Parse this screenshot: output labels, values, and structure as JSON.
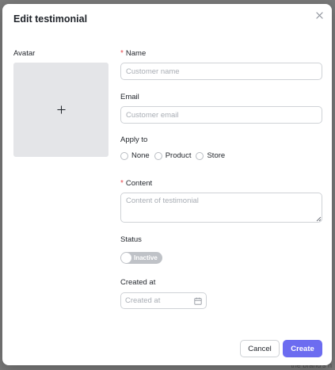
{
  "modal": {
    "title": "Edit testimonial"
  },
  "form": {
    "avatar_label": "Avatar",
    "name_label": "Name",
    "name_placeholder": "Customer name",
    "email_label": "Email",
    "email_placeholder": "Customer email",
    "apply_to_label": "Apply to",
    "apply_to_options": [
      "None",
      "Product",
      "Store"
    ],
    "content_label": "Content",
    "content_placeholder": "Content of testimonial",
    "status_label": "Status",
    "status_value": "Inactive",
    "created_at_label": "Created at",
    "created_at_placeholder": "Created at",
    "required_marker": "*"
  },
  "footer": {
    "cancel_label": "Cancel",
    "create_label": "Create"
  },
  "backdrop": {
    "snippet": "the brand's n"
  },
  "colors": {
    "primary": "#6c6cf0",
    "required": "#e5484d",
    "toggle_off": "#bfc2c7"
  }
}
